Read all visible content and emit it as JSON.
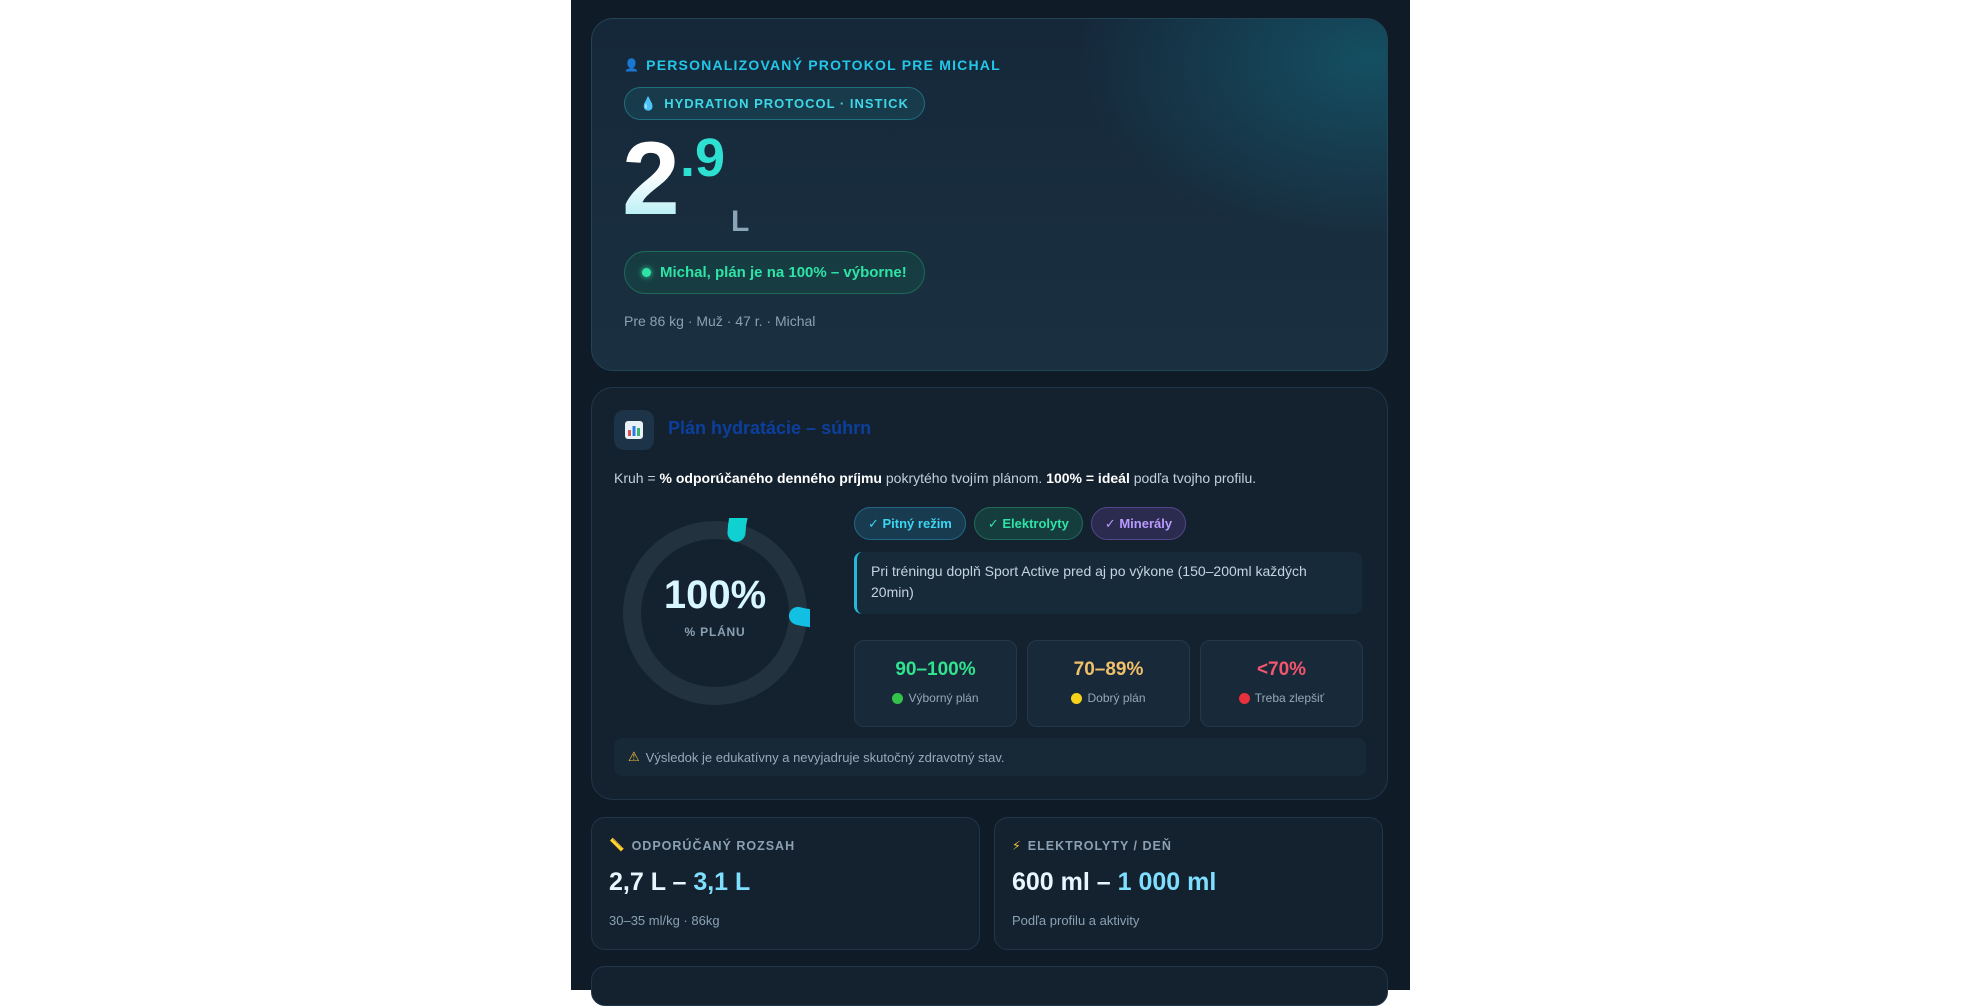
{
  "hero": {
    "profile_label": "PERSONALIZOVANÝ PROTOKOL PRE MICHAL",
    "badge": "HYDRATION PROTOCOL · INSTICK",
    "amount_int": "2",
    "amount_dec": ".9",
    "amount_unit": "L",
    "status": "Michal, plán je na 100% – výborne!",
    "meta": "Pre 86 kg · Muž · 47 r. · Michal"
  },
  "summary": {
    "icon": "chart-icon",
    "title": "Plán hydratácie – súhrn",
    "desc_prefix": "Kruh = ",
    "desc_bold1": "% odporúčaného denného príjmu",
    "desc_mid": " pokrytého tvojím plánom. ",
    "desc_bold2": "100% = ideál",
    "desc_suffix": " podľa tvojho profilu.",
    "ring_value": "100%",
    "ring_fraction": 1.0,
    "ring_label": "% PLÁNU",
    "chips": [
      "✓ Pitný režim",
      "✓ Elektrolyty",
      "✓ Minerály"
    ],
    "tip": "Pri tréningu doplň Sport Active pred aj po výkone (150–200ml každých 20min)",
    "tiers": [
      {
        "value": "90–100%",
        "label": "Výborný plán",
        "color": "#2fe38f",
        "dot": "#33c24a"
      },
      {
        "value": "70–89%",
        "label": "Dobrý plán",
        "color": "#f2c06a",
        "dot": "#f5d31a"
      },
      {
        "value": "<70%",
        "label": "Treba zlepšiť",
        "color": "#f2566e",
        "dot": "#e8313c"
      }
    ],
    "note": "Výsledok je edukatívny a nevyjadruje skutočný zdravotný stav."
  },
  "range_card": {
    "label": "ODPORÚČANÝ ROZSAH",
    "value_a": "2,7 L – ",
    "value_b": "3,1 L",
    "sub": "30–35 ml/kg · 86kg"
  },
  "electrolytes_card": {
    "label": "ELEKTROLYTY / DEŇ",
    "value_a": "600 ml – ",
    "value_b": "1 000 ml",
    "sub": "Podľa profilu a aktivity"
  },
  "colors": {
    "ring_start": "#0fd9c9",
    "ring_end": "#13b4f0",
    "ring_track": "#22323f"
  }
}
